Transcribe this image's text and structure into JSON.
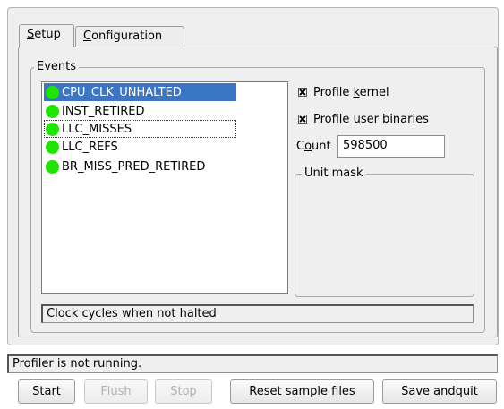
{
  "tabs": [
    {
      "pre": "",
      "mn": "S",
      "post": "etup"
    },
    {
      "pre": "",
      "mn": "C",
      "post": "onfiguration"
    }
  ],
  "events": {
    "group_label": "Events",
    "items": [
      {
        "label": "CPU_CLK_UNHALTED",
        "state": "selected"
      },
      {
        "label": "INST_RETIRED",
        "state": "normal"
      },
      {
        "label": "LLC_MISSES",
        "state": "focused"
      },
      {
        "label": "LLC_REFS",
        "state": "normal"
      },
      {
        "label": "BR_MISS_PRED_RETIRED",
        "state": "normal"
      }
    ],
    "description": "Clock cycles when not halted"
  },
  "options": {
    "profile_kernel": {
      "pre": "Profile ",
      "mn": "k",
      "post": "ernel",
      "checked": true
    },
    "profile_user": {
      "pre": "Profile ",
      "mn": "u",
      "post": "ser binaries",
      "checked": true
    },
    "count_label": {
      "pre": "C",
      "mn": "o",
      "post": "unt"
    },
    "count_value": "598500",
    "unit_mask_label": "Unit mask"
  },
  "status": "Profiler is not running.",
  "buttons": {
    "start": {
      "pre": "St",
      "mn": "a",
      "post": "rt"
    },
    "flush": {
      "pre": "",
      "mn": "F",
      "post": "lush"
    },
    "stop": "Stop",
    "reset": "Reset sample files",
    "save": {
      "pre": "Save and ",
      "mn": "q",
      "post": "uit"
    }
  },
  "colors": {
    "selection": "#3a76c4",
    "event_dot": "#1ee600"
  }
}
